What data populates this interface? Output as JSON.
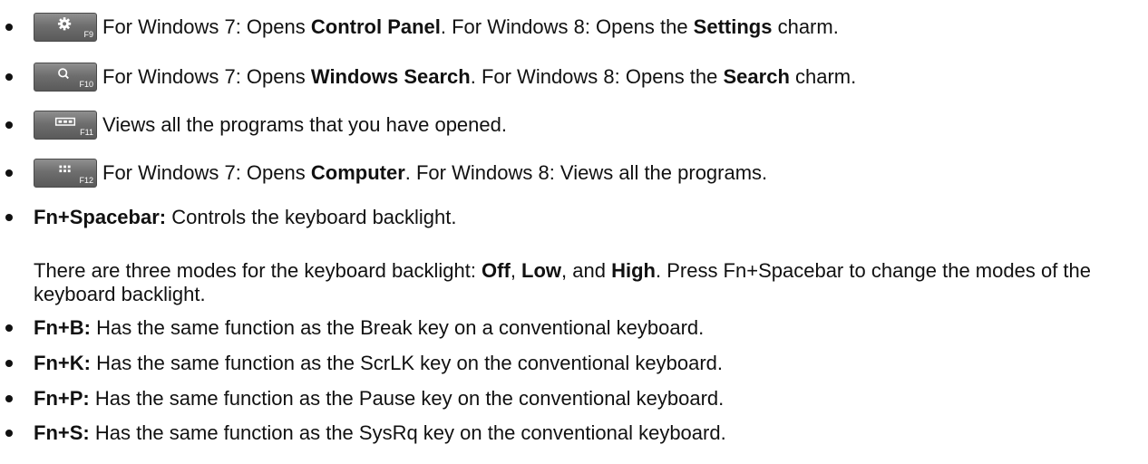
{
  "items": [
    {
      "key_icon": "gear-icon",
      "key_label": "F9",
      "parts": [
        "For Windows 7: Opens ",
        "Control Panel",
        ". For Windows 8: Opens the ",
        "Settings",
        " charm."
      ]
    },
    {
      "key_icon": "search-icon",
      "key_label": "F10",
      "parts": [
        "For Windows 7: Opens ",
        "Windows Search",
        ". For Windows 8: Opens the ",
        "Search",
        " charm."
      ]
    },
    {
      "key_icon": "task-view-icon",
      "key_label": "F11",
      "parts": [
        "Views all the programs that you have opened."
      ]
    },
    {
      "key_icon": "apps-grid-icon",
      "key_label": "F12",
      "parts": [
        "For Windows 7: Opens ",
        "Computer",
        ". For Windows 8: Views all the programs."
      ]
    },
    {
      "term": "Fn+Spacebar:",
      "desc": " Controls the keyboard backlight."
    },
    {
      "term": "Fn+B:",
      "desc": " Has the same function as the Break key on a conventional keyboard."
    },
    {
      "term": "Fn+K:",
      "desc": " Has the same function as the ScrLK key on the conventional keyboard."
    },
    {
      "term": "Fn+P:",
      "desc": " Has the same function as the Pause key on the conventional keyboard."
    },
    {
      "term": "Fn+S:",
      "desc": " Has the same function as the SysRq key on the conventional keyboard."
    }
  ],
  "backlight_note": {
    "parts": [
      "There are three modes for the keyboard backlight: ",
      "Off",
      ", ",
      "Low",
      ", and ",
      "High",
      ". Press Fn+Spacebar to change the modes of the keyboard backlight."
    ]
  }
}
